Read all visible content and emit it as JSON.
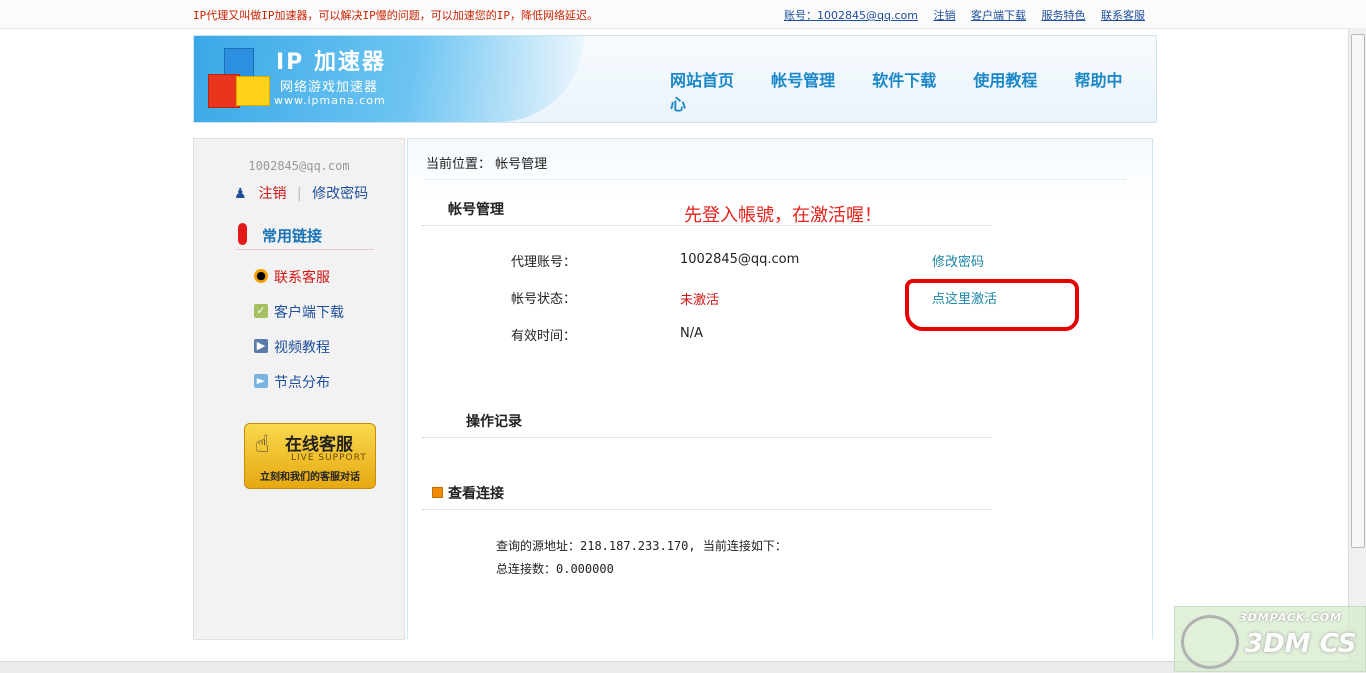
{
  "top": {
    "tagline": "IP代理又叫做IP加速器，可以解决IP慢的问题，可以加速您的IP，降低网络延迟。",
    "account_label": "账号：1002845@qq.com",
    "links": [
      "注销",
      "客户端下载",
      "服务特色",
      "联系客服"
    ]
  },
  "header": {
    "logo_title": "IP 加速器",
    "logo_subtitle": "网络游戏加速器",
    "logo_url": "www.ipmana.com",
    "nav": [
      "网站首页",
      "帐号管理",
      "软件下载",
      "使用教程",
      "帮助中心"
    ]
  },
  "sidebar": {
    "email": "1002845@qq.com",
    "logout": "注销",
    "separator": "|",
    "change_password": "修改密码",
    "section_title": "常用链接",
    "links": [
      {
        "label": "联系客服",
        "icon": "qq-icon"
      },
      {
        "label": "客户端下载",
        "icon": "download-icon"
      },
      {
        "label": "视频教程",
        "icon": "video-icon"
      },
      {
        "label": "节点分布",
        "icon": "node-icon"
      }
    ],
    "live_support": {
      "title": "在线客服",
      "sub": "LIVE SUPPORT",
      "caption": "立刻和我们的客服对话"
    }
  },
  "main": {
    "breadcrumb": "当前位置： 帐号管理",
    "account_section": "帐号管理",
    "annotation": "先登入帳號，在激活喔！",
    "rows": [
      {
        "label": "代理账号：",
        "value": "1002845@qq.com",
        "action": "修改密码"
      },
      {
        "label": "帐号状态：",
        "value": "未激活",
        "action": "点这里激活"
      },
      {
        "label": "有效时间：",
        "value": "N/A",
        "action": ""
      }
    ],
    "log_section": "操作记录",
    "conn_section": "查看连接",
    "source_line": "查询的源地址：218.187.233.170, 当前连接如下：",
    "total_line": "总连接数：0.000000"
  },
  "watermark": {
    "url": "3DMPACK.COM",
    "title": "3DM CS"
  },
  "colors": {
    "accent": "#1b87c9",
    "alert": "#d21515",
    "marker": "#e60000"
  }
}
